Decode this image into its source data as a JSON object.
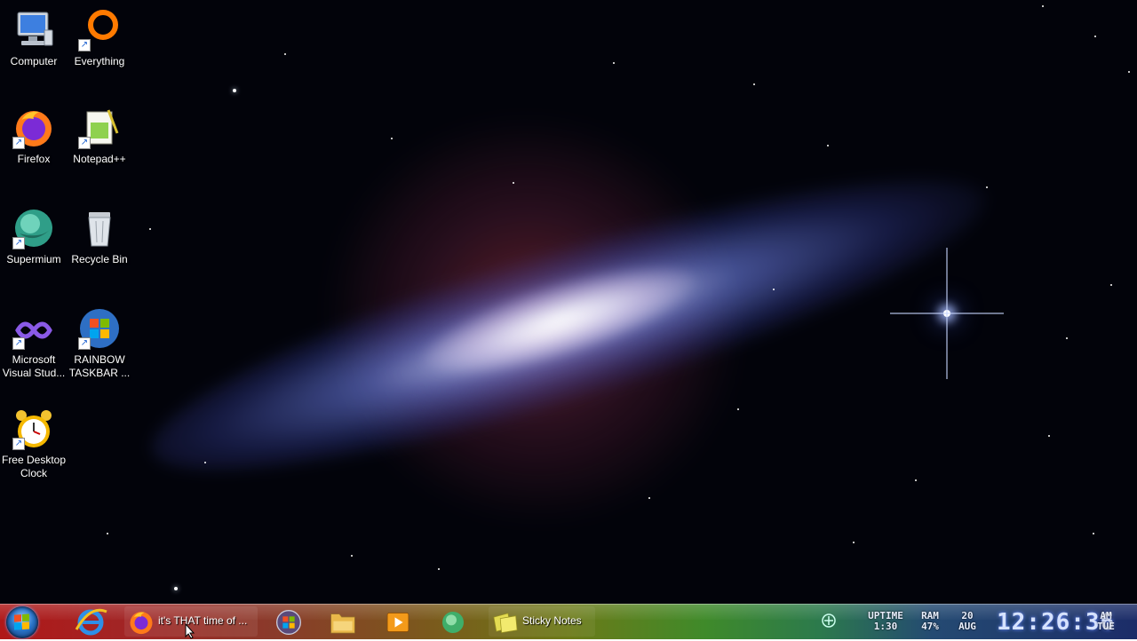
{
  "desktop": {
    "icons": [
      {
        "label": "Computer",
        "icon": "computer-icon"
      },
      {
        "label": "Everything",
        "icon": "everything-icon"
      },
      {
        "label": "Firefox",
        "icon": "firefox-icon"
      },
      {
        "label": "Notepad++",
        "icon": "notepad-plus-plus-icon"
      },
      {
        "label": "Supermium",
        "icon": "supermium-icon"
      },
      {
        "label": "Recycle Bin",
        "icon": "recycle-bin-icon"
      },
      {
        "label": "Microsoft Visual Stud...",
        "icon": "visual-studio-icon"
      },
      {
        "label": "RAINBOW TASKBAR ...",
        "icon": "windows-icon"
      },
      {
        "label": "Free Desktop Clock",
        "icon": "alarm-clock-icon"
      }
    ]
  },
  "taskbar": {
    "start_icon": "windows-orb-icon",
    "items": [
      {
        "label": "",
        "icon": "internet-explorer-icon"
      },
      {
        "label": "it's THAT time of ...",
        "icon": "firefox-icon"
      },
      {
        "label": "",
        "icon": "windows-orb-icon"
      },
      {
        "label": "",
        "icon": "folder-icon"
      },
      {
        "label": "",
        "icon": "media-player-icon"
      },
      {
        "label": "",
        "icon": "supermium-icon"
      },
      {
        "label": "Sticky Notes",
        "icon": "sticky-notes-icon"
      }
    ],
    "tray": {
      "icon": "add-icon",
      "uptime_label": "UPTIME",
      "uptime_value": "1:30",
      "ram_label": "RAM",
      "ram_value": "47%",
      "date_day": "20",
      "date_month": "AUG",
      "time": "12:26:36",
      "ampm": "AM",
      "weekday": "TUE"
    }
  },
  "colors": {
    "taskbar_red": "#b01818",
    "taskbar_green": "#6c7a18",
    "taskbar_blue": "#1c2c68",
    "desktop_bg": "#02030a"
  }
}
